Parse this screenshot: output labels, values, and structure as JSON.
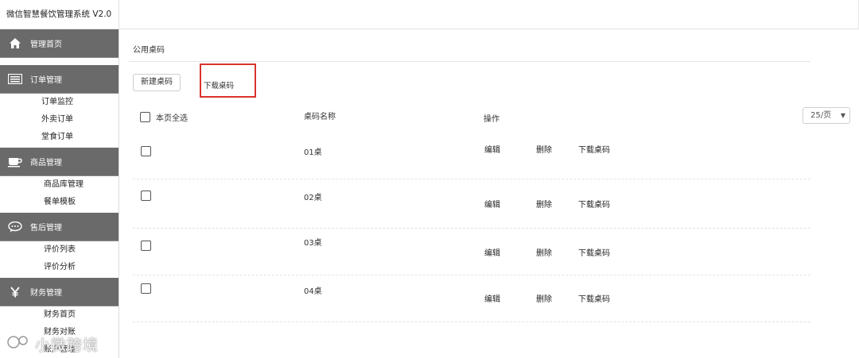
{
  "app": {
    "title": "微信智慧餐饮管理系统 V2.0"
  },
  "sidebar": {
    "groups": [
      {
        "label": "管理首页",
        "icon": "home-icon",
        "items": []
      },
      {
        "label": "订单管理",
        "icon": "list-icon",
        "items": [
          "订单监控",
          "外卖订单",
          "堂食订单"
        ]
      },
      {
        "label": "商品管理",
        "icon": "coffee-cup-icon",
        "items": [
          "商品库管理",
          "餐单模板"
        ]
      },
      {
        "label": "售后管理",
        "icon": "chat-bubble-icon",
        "items": [
          "评价列表",
          "评价分析"
        ]
      },
      {
        "label": "财务管理",
        "icon": "yen-icon",
        "items": [
          "财务首页",
          "财务对账",
          "账户管理"
        ]
      }
    ]
  },
  "main": {
    "title": "公用桌码",
    "new_button": "新建桌码",
    "download_button": "下载桌码",
    "table": {
      "select_all": "本页全选",
      "col_name": "桌码名称",
      "col_ops": "操作",
      "page_size": "25/页",
      "rows": [
        {
          "name": "01桌",
          "edit": "编辑",
          "delete": "删除",
          "download": "下载桌码"
        },
        {
          "name": "02桌",
          "edit": "编辑",
          "delete": "删除",
          "download": "下载桌码"
        },
        {
          "name": "03桌",
          "edit": "编辑",
          "delete": "删除",
          "download": "下载桌码"
        },
        {
          "name": "04桌",
          "edit": "编辑",
          "delete": "删除",
          "download": "下载桌码"
        }
      ]
    }
  },
  "watermark": {
    "text": "小微跨境"
  },
  "colors": {
    "sidebar_header": "#6a6a6a",
    "highlight_border": "#d9332b"
  }
}
